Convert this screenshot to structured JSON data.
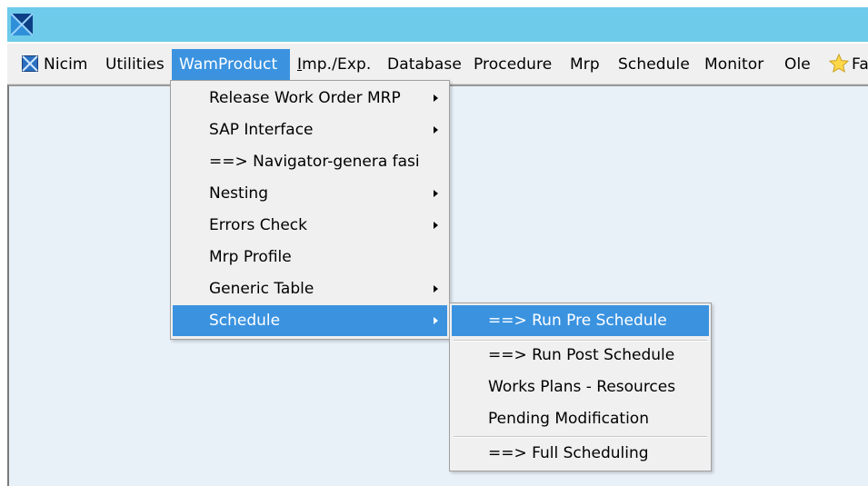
{
  "titlebar": {
    "icon": "app-logo-icon",
    "background": "#6ecbe9"
  },
  "menubar": {
    "items": [
      {
        "label": "Nicim",
        "icon": "nicim-icon"
      },
      {
        "label": "Utilities"
      },
      {
        "label": "WamProduct",
        "active": true
      },
      {
        "mnemonic": "I",
        "rest": "mp./Exp."
      },
      {
        "label": "Database"
      },
      {
        "label": "Procedure"
      },
      {
        "label": "Mrp"
      },
      {
        "label": "Schedule"
      },
      {
        "label": "Monitor"
      },
      {
        "label": "Ole"
      },
      {
        "label": "Fa",
        "icon": "star-icon"
      }
    ]
  },
  "menu_main": {
    "items": [
      {
        "label": "Release Work Order MRP",
        "submenu": true
      },
      {
        "label": "SAP Interface",
        "submenu": true
      },
      {
        "label": "==> Navigator-genera fasi",
        "submenu": false
      },
      {
        "label": "Nesting",
        "submenu": true
      },
      {
        "label": "Errors Check",
        "submenu": true
      },
      {
        "label": "Mrp Profile",
        "submenu": false
      },
      {
        "label": "Generic Table",
        "submenu": true
      },
      {
        "label": "Schedule",
        "submenu": true,
        "highlighted": true
      }
    ]
  },
  "menu_sub": {
    "items": [
      {
        "label": "==> Run Pre Schedule",
        "highlighted": true
      },
      {
        "label": "==> Run Post Schedule"
      },
      {
        "label": "Works Plans - Resources"
      },
      {
        "label": "Pending Modification"
      },
      {
        "label": "==> Full Scheduling"
      }
    ]
  },
  "colors": {
    "highlight": "#3b93e0",
    "menu_bg": "#f0f0f0",
    "workspace_bg": "#e8f0f8"
  }
}
